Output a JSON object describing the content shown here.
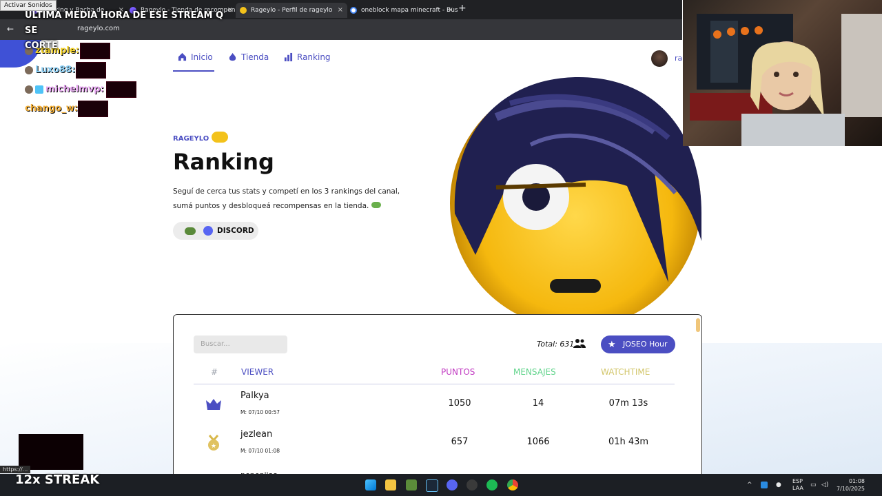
{
  "overlay": {
    "sound_label": "Activar Sonidos",
    "title_line1": "ULTIMA MEDIA HORA DE ESE STREAM Q SE",
    "title_line2": "CORTE",
    "streak": "12x STREAK"
  },
  "browser": {
    "tabs": [
      {
        "label": "Ranking y Racha de ..."
      },
      {
        "label": "Rageylo - Tienda de recompensas"
      },
      {
        "label": "Rageylo - Perfil de rageylo"
      },
      {
        "label": "oneblock mapa minecraft - Buscar"
      }
    ],
    "url": "rageylo.com",
    "status_url": "https://..."
  },
  "chat": [
    {
      "name": "ztample:",
      "color": "#f3d22b"
    },
    {
      "name": "Luxo88:",
      "color": "#8fd1f6"
    },
    {
      "name": "michelmvp:",
      "color": "#e6a6f0"
    },
    {
      "name": "chango_w:",
      "color": "#f3b03b"
    }
  ],
  "nav": {
    "items": [
      {
        "label": "Inicio",
        "icon": "home-icon"
      },
      {
        "label": "Tienda",
        "icon": "fire-icon"
      },
      {
        "label": "Ranking",
        "icon": "bar-chart-icon"
      }
    ],
    "user_initial": "ra"
  },
  "hero": {
    "kicker": "RAGEYLO",
    "title": "Ranking",
    "description": "Seguí de cerca tus stats y competí en los 3 rankings del canal, sumá puntos y desbloqueá recompensas en la tienda.",
    "discord_label": "DISCORD"
  },
  "table": {
    "search_placeholder": "Buscar...",
    "total_label": "Total: 631",
    "joseo_label": "JOSEO Hour",
    "headers": {
      "rank": "#",
      "viewer": "VIEWER",
      "puntos": "PUNTOS",
      "mensajes": "MENSAJES",
      "watchtime": "WATCHTIME"
    },
    "header_colors": {
      "rank": "#9ea3ad",
      "viewer": "#4b4ec2",
      "puntos": "#c13ac2",
      "mensajes": "#5fd38a",
      "watchtime": "#d2c66b"
    },
    "rows": [
      {
        "name": "Palkya",
        "sub": "M: 07/10 00:57",
        "puntos": "1050",
        "mensajes": "14",
        "watchtime": "07m 13s",
        "icon": "crown-icon"
      },
      {
        "name": "jezlean",
        "sub": "M: 07/10 01:08",
        "puntos": "657",
        "mensajes": "1066",
        "watchtime": "01h 43m",
        "icon": "medal-icon"
      }
    ],
    "row3_partial": "pepepiiaa"
  },
  "taskbar": {
    "lang": "ESP",
    "lang2": "LAA",
    "time": "01:08",
    "date": "7/10/2025"
  }
}
